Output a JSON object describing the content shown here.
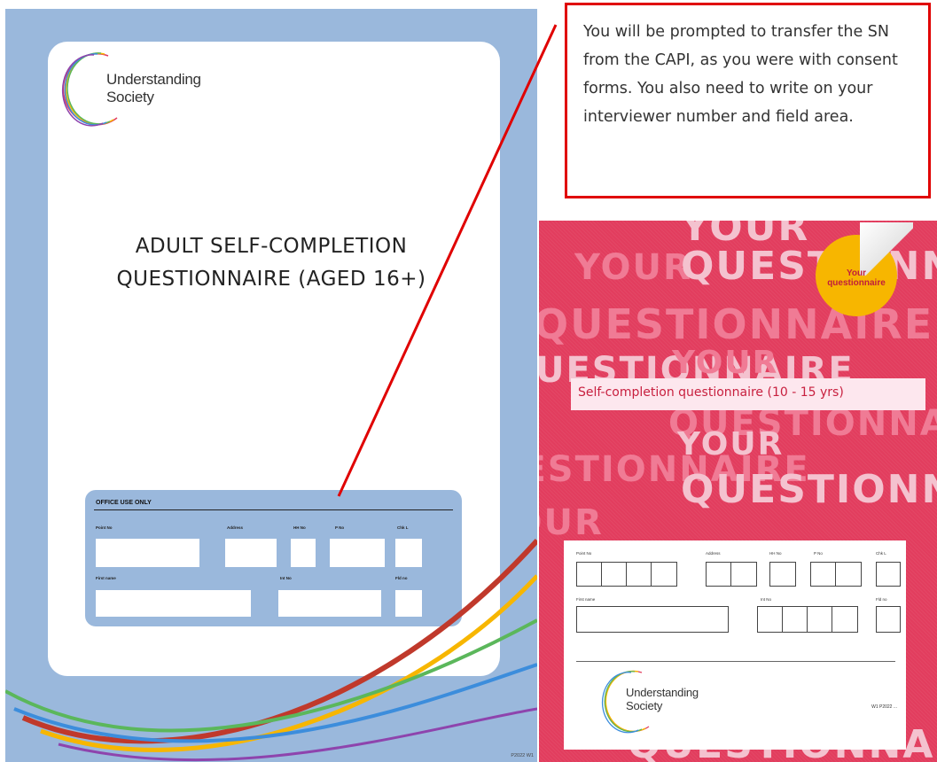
{
  "adult_booklet": {
    "logo_text_line1": "Understanding",
    "logo_text_line2": "Society",
    "title_line1": "ADULT SELF-COMPLETION",
    "title_line2": "QUESTIONNAIRE (AGED 16+)",
    "office": {
      "heading": "OFFICE USE ONLY",
      "labels": [
        "Point No",
        "Address",
        "HH No",
        "P No",
        "Chk L",
        "First name",
        "Int No",
        "Fld no"
      ]
    },
    "code": "P2022 W1"
  },
  "callout": {
    "text": "You will be prompted to transfer the SN from the CAPI, as you were with consent forms. You also need to write on your interviewer number and field area."
  },
  "youth_booklet": {
    "pattern_words": [
      "YOUR",
      "QUESTIONNAIRE"
    ],
    "sticker_line1": "Your",
    "sticker_line2": "questionnaire",
    "subtitle": "Self-completion questionnaire (10 - 15 yrs)",
    "form_labels": [
      "Point No",
      "Address",
      "HH No",
      "P No",
      "Chk L",
      "First name",
      "Int No",
      "Fld no"
    ],
    "logo_text_line1": "Understanding",
    "logo_text_line2": "Society",
    "code": "W1 P2022 ..."
  },
  "colors": {
    "adult_cover_blue": "#9ab8dc",
    "youth_cover_pink": "#e23d5e",
    "callout_border_red": "#e00000",
    "sticker_yellow": "#f7b600"
  }
}
